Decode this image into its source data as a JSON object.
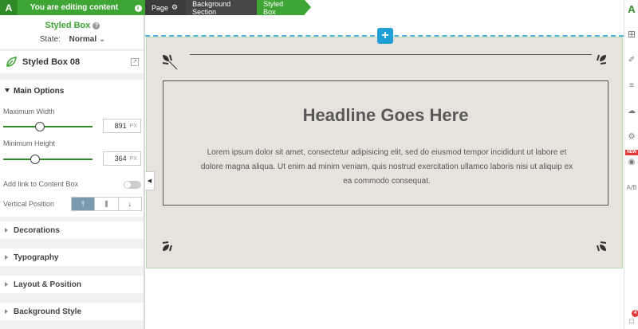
{
  "topbar": {
    "logo": "A",
    "message": "You are editing content",
    "info_icon": "i"
  },
  "header": {
    "title": "Styled Box",
    "help": "?",
    "state_label": "State:",
    "state_value": "Normal"
  },
  "element": {
    "name": "Styled Box 08"
  },
  "main_options": {
    "title": "Main Options",
    "max_width": {
      "label": "Maximum Width",
      "value": "891",
      "unit": "PX",
      "fraction": 0.42
    },
    "min_height": {
      "label": "Minimum Height",
      "value": "364",
      "unit": "PX",
      "fraction": 0.36
    },
    "link_label": "Add link to Content Box",
    "vertical_position_label": "Vertical Position",
    "vertical_position_options": [
      "⤒",
      "⫼",
      "↓"
    ]
  },
  "sections": [
    "Decorations",
    "Typography",
    "Layout & Position",
    "Background Style"
  ],
  "breadcrumb": [
    "Page",
    "Background Section",
    "Styled Box"
  ],
  "canvas": {
    "headline": "Headline Goes Here",
    "body": "Lorem ipsum dolor sit amet, consectetur adipisicing elit, sed do eiusmod tempor incididunt ut labore et dolore magna aliqua. Ut enim ad minim veniam, quis nostrud exercitation ullamco laboris nisi ut aliquip ex ea commodo consequat.",
    "add_label": "+"
  },
  "rail": {
    "new_badge": "NEW",
    "count_badge": "4",
    "ab_label": "A/B"
  },
  "colors": {
    "accent_green": "#3fa535",
    "dark_bar": "#3b3b3b",
    "blue": "#1e9fd6",
    "section_bg": "#e7e3dc"
  }
}
